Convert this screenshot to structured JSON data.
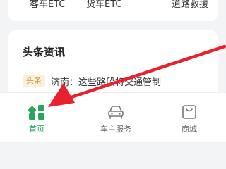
{
  "services": {
    "items": [
      "客车ETC",
      "货车ETC",
      "道路救援"
    ]
  },
  "news": {
    "title": "头条资讯",
    "tag": "头条",
    "headline": "济南：这些路段将交通管制"
  },
  "tabbar": {
    "tabs": [
      {
        "label": "首页",
        "icon": "home-grid-icon",
        "active": true
      },
      {
        "label": "车主服务",
        "icon": "car-icon",
        "active": false
      },
      {
        "label": "商城",
        "icon": "shopping-bag-icon",
        "active": false
      }
    ]
  },
  "colors": {
    "accent": "#2aa560",
    "annotation": "#e8212e",
    "tag_bg": "#fbf0d9",
    "tag_text": "#c59a3e"
  }
}
